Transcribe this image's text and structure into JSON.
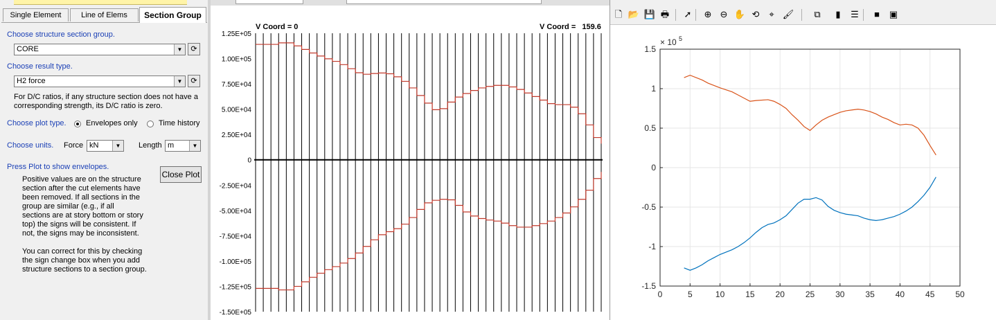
{
  "left_panel": {
    "tabs": [
      {
        "label": "Single Element",
        "active": false
      },
      {
        "label": "Line of Elems",
        "active": false
      },
      {
        "label": "Section Group",
        "active": true
      }
    ],
    "section_group_label": "Choose structure section group.",
    "section_group_value": "CORE",
    "result_type_label": "Choose result type.",
    "result_type_value": "H2 force",
    "dc_note": "For D/C ratios, if any structure section does not have a corresponding strength, its D/C ratio is zero.",
    "plot_type_label": "Choose plot type.",
    "plot_type_options": [
      {
        "label": "Envelopes only",
        "selected": true
      },
      {
        "label": "Time history",
        "selected": false
      }
    ],
    "units_label": "Choose units.",
    "force_label": "Force",
    "force_value": "kN",
    "length_label": "Length",
    "length_value": "m",
    "press_plot_label": "Press Plot to show envelopes.",
    "close_plot_label": "Close Plot",
    "info_text_1": "Positive values are on the structure section after the cut elements have been removed. If all sections in the group are similar (e.g., if all sections are at story bottom or story top) the signs will be consistent. If not, the signs may be inconsistent.",
    "info_text_2": "You can correct for this by checking the sign change box when you add structure sections to a section group."
  },
  "middle_plot": {
    "v_coord_left": "V Coord = 0",
    "v_coord_right_label": "V Coord =",
    "v_coord_right_value": "159.6",
    "y_tick_labels": [
      "1.25E+05",
      "1.00E+05",
      "7.50E+04",
      "5.00E+04",
      "2.50E+04",
      "0",
      "-2.50E+04",
      "-5.00E+04",
      "-7.50E+04",
      "-1.00E+05",
      "-1.25E+05",
      "-1.50E+05"
    ],
    "y_tick_values": [
      125000,
      100000,
      75000,
      50000,
      25000,
      0,
      -25000,
      -50000,
      -75000,
      -100000,
      -125000,
      -150000
    ],
    "vertical_lines_count": 46,
    "curve_color": "#c0392b"
  },
  "right_figure": {
    "toolbar_icons": [
      "new-file-icon",
      "open-folder-icon",
      "save-icon",
      "print-icon",
      "pointer-arrow-icon",
      "zoom-in-icon",
      "zoom-out-icon",
      "pan-hand-icon",
      "rotate-3d-icon",
      "data-cursor-icon",
      "brush-icon",
      "link-plot-icon",
      "colorbar-icon",
      "legend-icon",
      "hide-plot-tools-icon",
      "show-plot-tools-icon"
    ]
  },
  "chart_data": {
    "type": "line",
    "exponent_label": "× 10",
    "exponent_power": "5",
    "x_ticks": [
      0,
      5,
      10,
      15,
      20,
      25,
      30,
      35,
      40,
      45,
      50
    ],
    "y_ticks": [
      1.5,
      1,
      0.5,
      0,
      -0.5,
      -1,
      -1.5
    ],
    "xlim": [
      0,
      50
    ],
    "ylim": [
      -1.5,
      1.5
    ],
    "grid": true,
    "series": [
      {
        "color": "#d95319",
        "x": [
          4,
          5,
          7,
          8,
          10,
          12,
          13,
          15,
          16,
          18,
          19,
          20,
          21,
          22,
          23,
          24,
          25,
          26,
          27,
          28,
          29,
          30,
          31,
          32,
          33,
          34,
          35,
          36,
          37,
          38,
          39,
          40,
          41,
          42,
          43,
          44,
          45,
          46
        ],
        "y": [
          1.14,
          1.17,
          1.11,
          1.07,
          1.01,
          0.96,
          0.92,
          0.84,
          0.85,
          0.86,
          0.84,
          0.8,
          0.75,
          0.67,
          0.6,
          0.52,
          0.47,
          0.54,
          0.6,
          0.64,
          0.67,
          0.7,
          0.72,
          0.73,
          0.74,
          0.73,
          0.71,
          0.68,
          0.64,
          0.61,
          0.57,
          0.54,
          0.55,
          0.54,
          0.5,
          0.41,
          0.28,
          0.16
        ]
      },
      {
        "color": "#0072bd",
        "x": [
          4,
          5,
          6,
          7,
          8,
          9,
          10,
          12,
          13,
          14,
          15,
          16,
          17,
          18,
          19,
          20,
          21,
          22,
          23,
          24,
          25,
          26,
          27,
          28,
          29,
          30,
          31,
          32,
          33,
          34,
          35,
          36,
          37,
          38,
          39,
          40,
          41,
          42,
          43,
          44,
          45,
          46
        ],
        "y": [
          -1.27,
          -1.3,
          -1.27,
          -1.23,
          -1.18,
          -1.14,
          -1.1,
          -1.04,
          -1.0,
          -0.95,
          -0.89,
          -0.82,
          -0.76,
          -0.72,
          -0.7,
          -0.66,
          -0.61,
          -0.53,
          -0.45,
          -0.4,
          -0.4,
          -0.38,
          -0.41,
          -0.49,
          -0.54,
          -0.57,
          -0.59,
          -0.6,
          -0.61,
          -0.64,
          -0.66,
          -0.67,
          -0.66,
          -0.64,
          -0.62,
          -0.59,
          -0.55,
          -0.5,
          -0.43,
          -0.35,
          -0.25,
          -0.12
        ]
      }
    ]
  }
}
